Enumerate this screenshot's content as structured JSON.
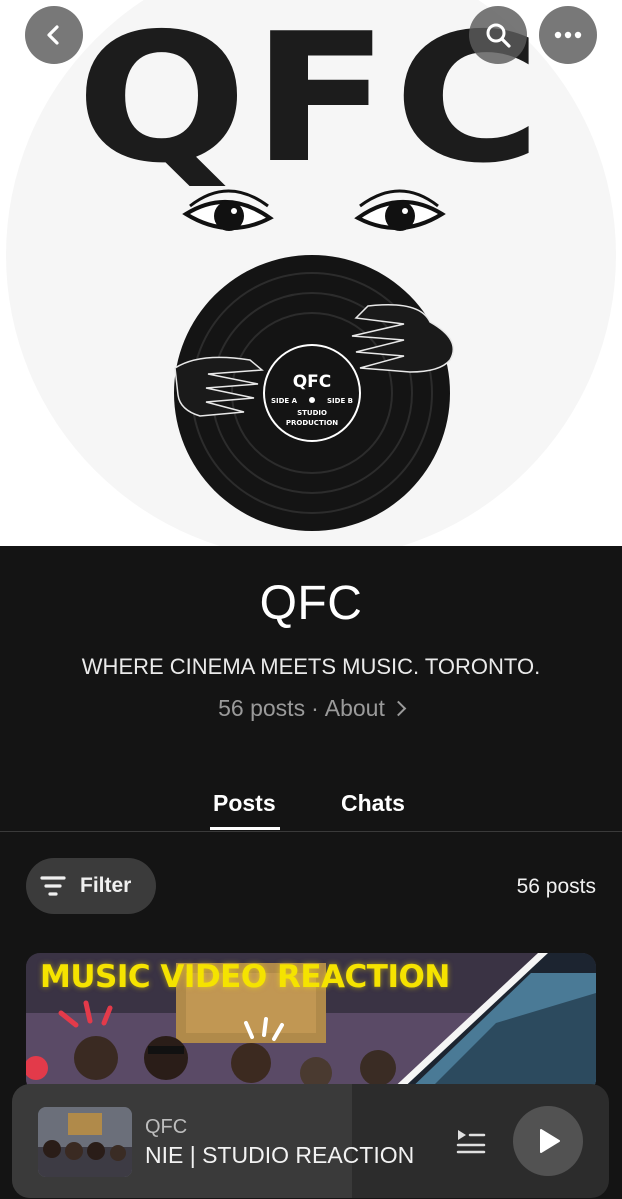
{
  "hero": {
    "logo_text": "QFC",
    "record_label": {
      "brand": "QFC",
      "side_a": "SIDE A",
      "side_b": "SIDE B",
      "line1": "STUDIO",
      "line2": "PRODUCTION"
    },
    "icons": [
      "chevron-left-icon",
      "search-icon",
      "more-horizontal-icon"
    ]
  },
  "channel": {
    "name": "QFC",
    "tagline": "WHERE CINEMA MEETS MUSIC. TORONTO.",
    "posts_meta": "56 posts",
    "separator": "·",
    "about_label": "About"
  },
  "tabs": [
    {
      "label": "Posts",
      "active": true
    },
    {
      "label": "Chats",
      "active": false
    }
  ],
  "filter": {
    "label": "Filter",
    "posts_count": "56 posts"
  },
  "post": {
    "thumbnail_title": "MUSIC VIDEO REACTION"
  },
  "player": {
    "channel": "QFC",
    "title": "NIE | STUDIO REACTION",
    "state": "paused"
  },
  "colors": {
    "background": "#141414",
    "hero_background": "#ffffff",
    "accent_yellow": "#f5e300",
    "filter_pill": "#3b3b3b",
    "player_background": "#2c2c2c"
  }
}
